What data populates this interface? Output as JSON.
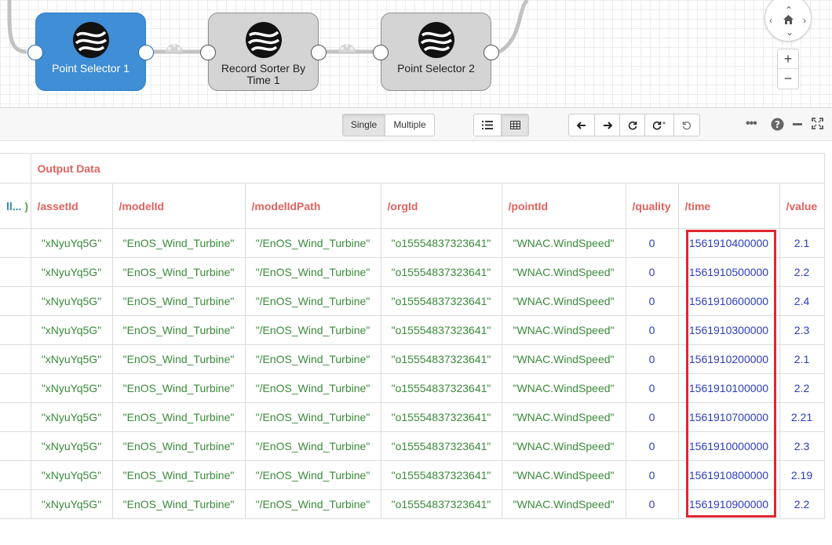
{
  "canvas": {
    "nodes": [
      {
        "label": "Point Selector 1",
        "selected": true
      },
      {
        "label": "Record Sorter By Time 1",
        "selected": false
      },
      {
        "label": "Point Selector 2",
        "selected": false
      }
    ]
  },
  "toolbar": {
    "single_label": "Single",
    "multiple_label": "Multiple",
    "zoom_in": "+",
    "zoom_out": "−"
  },
  "table": {
    "group_header": "Output Data",
    "lead_header": "ll... )",
    "columns": [
      "/assetId",
      "/modelId",
      "/modelIdPath",
      "/orgId",
      "/pointId",
      "/quality",
      "/time",
      "/value"
    ],
    "rows": [
      [
        "\"xNyuYq5G\"",
        "\"EnOS_Wind_Turbine\"",
        "\"/EnOS_Wind_Turbine\"",
        "\"o15554837323641\"",
        "\"WNAC.WindSpeed\"",
        "0",
        "1561910400000",
        "2.1"
      ],
      [
        "\"xNyuYq5G\"",
        "\"EnOS_Wind_Turbine\"",
        "\"/EnOS_Wind_Turbine\"",
        "\"o15554837323641\"",
        "\"WNAC.WindSpeed\"",
        "0",
        "1561910500000",
        "2.2"
      ],
      [
        "\"xNyuYq5G\"",
        "\"EnOS_Wind_Turbine\"",
        "\"/EnOS_Wind_Turbine\"",
        "\"o15554837323641\"",
        "\"WNAC.WindSpeed\"",
        "0",
        "1561910600000",
        "2.4"
      ],
      [
        "\"xNyuYq5G\"",
        "\"EnOS_Wind_Turbine\"",
        "\"/EnOS_Wind_Turbine\"",
        "\"o15554837323641\"",
        "\"WNAC.WindSpeed\"",
        "0",
        "1561910300000",
        "2.3"
      ],
      [
        "\"xNyuYq5G\"",
        "\"EnOS_Wind_Turbine\"",
        "\"/EnOS_Wind_Turbine\"",
        "\"o15554837323641\"",
        "\"WNAC.WindSpeed\"",
        "0",
        "1561910200000",
        "2.1"
      ],
      [
        "\"xNyuYq5G\"",
        "\"EnOS_Wind_Turbine\"",
        "\"/EnOS_Wind_Turbine\"",
        "\"o15554837323641\"",
        "\"WNAC.WindSpeed\"",
        "0",
        "1561910100000",
        "2.2"
      ],
      [
        "\"xNyuYq5G\"",
        "\"EnOS_Wind_Turbine\"",
        "\"/EnOS_Wind_Turbine\"",
        "\"o15554837323641\"",
        "\"WNAC.WindSpeed\"",
        "0",
        "1561910700000",
        "2.21"
      ],
      [
        "\"xNyuYq5G\"",
        "\"EnOS_Wind_Turbine\"",
        "\"/EnOS_Wind_Turbine\"",
        "\"o15554837323641\"",
        "\"WNAC.WindSpeed\"",
        "0",
        "1561910000000",
        "2.3"
      ],
      [
        "\"xNyuYq5G\"",
        "\"EnOS_Wind_Turbine\"",
        "\"/EnOS_Wind_Turbine\"",
        "\"o15554837323641\"",
        "\"WNAC.WindSpeed\"",
        "0",
        "1561910800000",
        "2.19"
      ],
      [
        "\"xNyuYq5G\"",
        "\"EnOS_Wind_Turbine\"",
        "\"/EnOS_Wind_Turbine\"",
        "\"o15554837323641\"",
        "\"WNAC.WindSpeed\"",
        "0",
        "1561910900000",
        "2.2"
      ]
    ],
    "column_kinds": [
      "str",
      "str",
      "str",
      "str",
      "str",
      "num",
      "num",
      "num"
    ]
  },
  "colors": {
    "selected_node": "#3f8ed6",
    "header_text": "#e2625e",
    "string_value": "#3a8a3a",
    "number_value": "#2b3dbf",
    "highlight_border": "#e0262e"
  },
  "icons": [
    "enos-logo-icon",
    "link-flow-icon",
    "pan-up-icon",
    "pan-down-icon",
    "pan-left-icon",
    "pan-right-icon",
    "home-icon",
    "list-view-icon",
    "grid-view-icon",
    "arrow-left-icon",
    "arrow-right-icon",
    "refresh-icon",
    "refresh-all-icon",
    "undo-icon",
    "more-icon",
    "help-icon",
    "minimize-icon",
    "fullscreen-icon"
  ]
}
